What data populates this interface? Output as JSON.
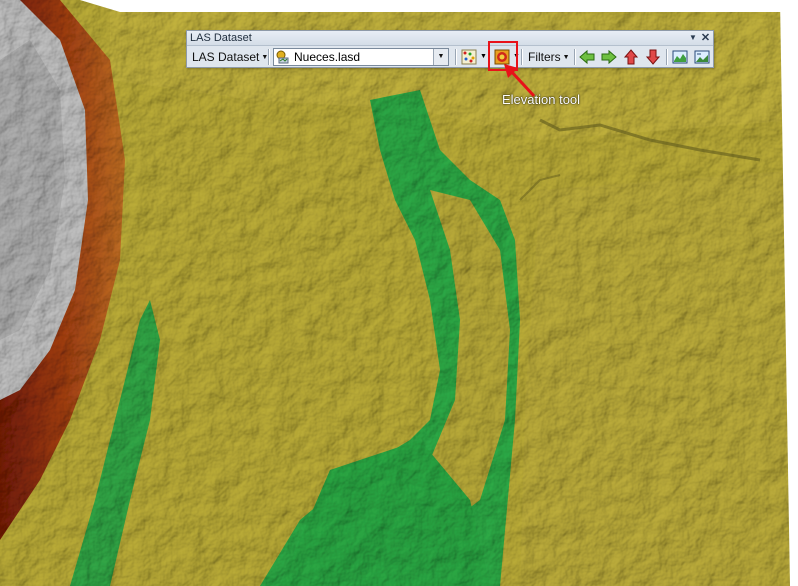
{
  "window": {
    "title": "LAS Dataset"
  },
  "toolbar": {
    "las_menu_label": "LAS Dataset",
    "dataset_combo_value": "Nueces.lasd",
    "filters_label": "Filters"
  },
  "annotation": {
    "label": "Elevation tool",
    "color": "#e8121a"
  },
  "colors": {
    "terrain_yellow": "#b5a637",
    "terrain_green": "#2aa142",
    "terrain_brown": "#8a2a0a",
    "terrain_gray": "#b8b8b8"
  },
  "icons": [
    "layer-dataset-icon",
    "point-filter-icon",
    "elevation-tool-icon",
    "arrow-left-icon",
    "arrow-right-icon",
    "arrow-up-icon",
    "arrow-down-icon",
    "profile-view-icon",
    "3d-view-icon"
  ]
}
